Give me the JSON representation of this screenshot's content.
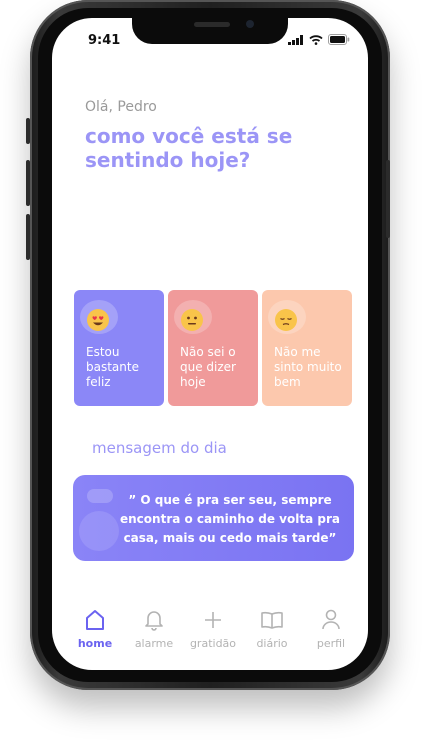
{
  "status_bar": {
    "time": "9:41"
  },
  "header": {
    "greeting": "Olá, Pedro",
    "question": "como você está se sentindo hoje?"
  },
  "moods": [
    {
      "label": "Estou bastante feliz",
      "color": "#8b87f7",
      "icon": "heart-eyes-emoji-icon"
    },
    {
      "label": "Não sei o que dizer hoje",
      "color": "#f09a9a",
      "icon": "neutral-face-emoji-icon"
    },
    {
      "label": "Não me sinto muito bem",
      "color": "#fcc8ad",
      "icon": "pensive-face-emoji-icon"
    }
  ],
  "message": {
    "title": "mensagem do dia",
    "text": "” O que é pra ser seu, sempre encontra o caminho de volta pra casa, mais ou cedo mais tarde”"
  },
  "nav": [
    {
      "label": "home",
      "icon": "home-icon",
      "active": true
    },
    {
      "label": "alarme",
      "icon": "bell-icon",
      "active": false
    },
    {
      "label": "gratidão",
      "icon": "plus-icon",
      "active": false
    },
    {
      "label": "diário",
      "icon": "book-icon",
      "active": false
    },
    {
      "label": "perfil",
      "icon": "user-icon",
      "active": false
    }
  ],
  "colors": {
    "accent": "#6b63f0",
    "accent_light": "#9b95f6",
    "inactive": "#b3b3b3"
  }
}
